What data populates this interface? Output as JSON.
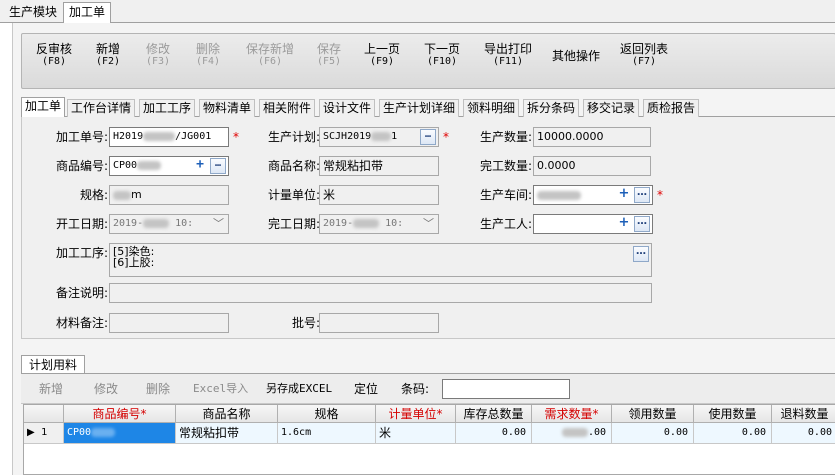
{
  "module_tabs": [
    "生产模块",
    "加工单"
  ],
  "toolbar": [
    {
      "label": "反审核",
      "key": "(F8)",
      "enabled": true
    },
    {
      "label": "新增",
      "key": "(F2)",
      "enabled": true
    },
    {
      "label": "修改",
      "key": "(F3)",
      "enabled": false
    },
    {
      "label": "删除",
      "key": "(F4)",
      "enabled": false
    },
    {
      "label": "保存新增",
      "key": "(F6)",
      "enabled": false
    },
    {
      "label": "保存",
      "key": "(F5)",
      "enabled": false
    },
    {
      "label": "上一页",
      "key": "(F9)",
      "enabled": true
    },
    {
      "label": "下一页",
      "key": "(F10)",
      "enabled": true
    },
    {
      "label": "导出打印",
      "key": "(F11)",
      "enabled": true
    },
    {
      "label": "其他操作",
      "key": "",
      "enabled": true
    },
    {
      "label": "返回列表",
      "key": "(F7)",
      "enabled": true
    }
  ],
  "form_tabs": [
    "加工单",
    "工作台详情",
    "加工工序",
    "物料清单",
    "相关附件",
    "设计文件",
    "生产计划详细",
    "领料明细",
    "拆分条码",
    "移交记录",
    "质检报告"
  ],
  "form": {
    "order_no_label": "加工单号:",
    "order_no_a": "H2019",
    "order_no_b": "/JG001",
    "plan_label": "生产计划:",
    "plan_value": "SCJH2019",
    "plan_suffix": "1",
    "qty_label": "生产数量:",
    "qty_value": "10000.0000",
    "product_code_label": "商品编号:",
    "product_code_value": "CP00",
    "product_name_label": "商品名称:",
    "product_name_value": "常规粘扣带",
    "done_qty_label": "完工数量:",
    "done_qty_value": "0.0000",
    "spec_label": "规格:",
    "spec_value": "m",
    "unit_label": "计量单位:",
    "unit_value": "米",
    "workshop_label": "生产车间:",
    "start_label": "开工日期:",
    "start_value": "2019-",
    "start_time": "10:",
    "end_label": "完工日期:",
    "end_value": "2019-",
    "end_time": "10:",
    "worker_label": "生产工人:",
    "process_label": "加工工序:",
    "process_lines": [
      "[5]染色:",
      "[6]上胶:"
    ],
    "remark_label": "备注说明:",
    "material_note_label": "材料备注:",
    "batch_label": "批号:"
  },
  "plan": {
    "tab": "计划用料",
    "toolbar": [
      {
        "label": "新增",
        "enabled": false
      },
      {
        "label": "修改",
        "enabled": false
      },
      {
        "label": "删除",
        "enabled": false
      },
      {
        "label": "Excel导入",
        "enabled": false
      },
      {
        "label": "另存成EXCEL",
        "enabled": true
      },
      {
        "label": "定位",
        "enabled": true
      }
    ],
    "barcode_label": "条码:",
    "columns": [
      "商品编号*",
      "商品名称",
      "规格",
      "计量单位*",
      "库存总数量",
      "需求数量*",
      "领用数量",
      "使用数量",
      "退料数量"
    ],
    "rows": [
      {
        "indicator": "▶",
        "num": "1",
        "code": "CP00",
        "name": "常规粘扣带",
        "spec": "1.6cm",
        "unit": "米",
        "stock": "0.00",
        "demand": ".00",
        "used": "0.00",
        "usage": "0.00",
        "returned": "0.00"
      }
    ]
  }
}
